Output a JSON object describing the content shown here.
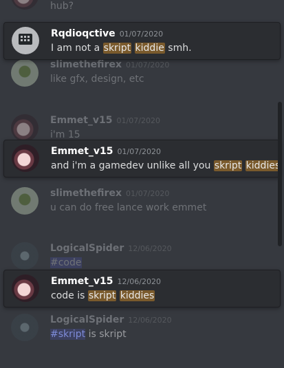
{
  "top_fragment": {
    "text": "hub?"
  },
  "cards": [
    {
      "author": "Rqdioqctive",
      "time": "01/07/2020",
      "parts": [
        "I am not a ",
        "skript",
        " ",
        "kiddie",
        " smh."
      ]
    },
    {
      "author": "Emmet_v15",
      "time": "01/07/2020",
      "parts": [
        "and i'm a gamedev unlike all you ",
        "skript",
        " ",
        "kiddies",
        ""
      ]
    },
    {
      "author": "Emmet_v15",
      "time": "12/06/2020",
      "parts": [
        "code is ",
        "skript",
        " ",
        "kiddies",
        ""
      ]
    }
  ],
  "background_messages": [
    {
      "author": "slimethefirex",
      "time": "01/07/2020",
      "text": "like gfx, design, etc"
    },
    {
      "author": "Emmet_v15",
      "time": "01/07/2020",
      "text": "i'm 15"
    },
    {
      "author": "slimethefirex",
      "time": "01/07/2020",
      "text": "u can do free lance work emmet"
    },
    {
      "author": "LogicalSpider",
      "time": "12/06/2020",
      "text": "#code"
    },
    {
      "author": "LogicalSpider",
      "time": "12/06/2020",
      "mention": "#skript",
      "text": " is skript"
    }
  ]
}
